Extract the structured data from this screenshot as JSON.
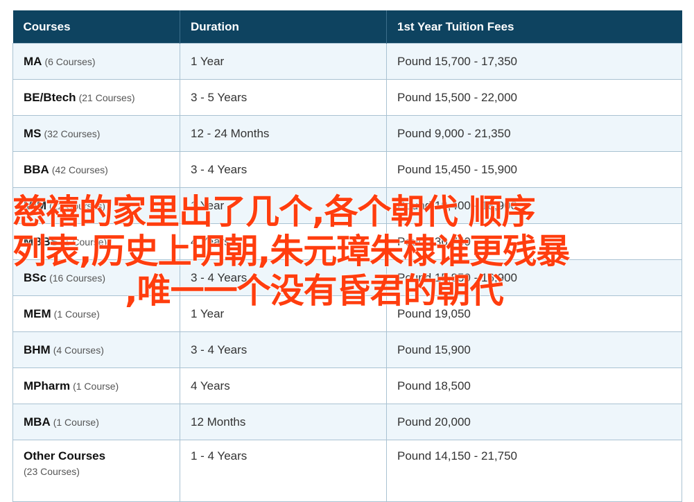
{
  "table": {
    "headers": [
      "Courses",
      "Duration",
      "1st Year Tuition Fees"
    ],
    "rows": [
      {
        "name": "MA",
        "count": "(6 Courses)",
        "duration": "1 Year",
        "fee": "Pound 15,700 - 17,350"
      },
      {
        "name": "BE/Btech",
        "count": "(21 Courses)",
        "duration": "3 - 5 Years",
        "fee": "Pound 15,500 - 22,000"
      },
      {
        "name": "MS",
        "count": "(32 Courses)",
        "duration": "12 - 24 Months",
        "fee": "Pound 9,000 - 21,350"
      },
      {
        "name": "BBA",
        "count": "(42 Courses)",
        "duration": "3 - 4 Years",
        "fee": "Pound 15,450 - 15,900"
      },
      {
        "name": "MIM",
        "count": "(22 Courses)",
        "duration": "1 Year",
        "fee": "Pound 19,400 - 18,900"
      },
      {
        "name": "MBBS",
        "count": "(1 Course)",
        "duration": "4 Years",
        "fee": "Pound 36,750"
      },
      {
        "name": "BSc",
        "count": "(16 Courses)",
        "duration": "3 - 4 Years",
        "fee": "Pound 15,850 - 16,900"
      },
      {
        "name": "MEM",
        "count": "(1 Course)",
        "duration": "1 Year",
        "fee": "Pound 19,050"
      },
      {
        "name": "BHM",
        "count": "(4 Courses)",
        "duration": "3 - 4 Years",
        "fee": "Pound 15,900"
      },
      {
        "name": "MPharm",
        "count": "(1 Course)",
        "duration": "4 Years",
        "fee": "Pound 18,500"
      },
      {
        "name": "MBA",
        "count": "(1 Course)",
        "duration": "12 Months",
        "fee": "Pound 20,000"
      },
      {
        "name": "Other Courses",
        "count": "(23 Courses)",
        "duration": "1 - 4 Years",
        "fee": "Pound 14,150 - 21,750"
      }
    ]
  },
  "overlay": {
    "lines": [
      "慈禧的家里出了几个,各个朝代 顺序",
      "列表,历史上明朝,朱元璋朱棣谁更残暴",
      ",唯一一个没有昏君的朝代"
    ]
  },
  "colors": {
    "header_bg": "#0e4360",
    "row_alt_bg": "#eef6fb",
    "border": "#a9c2d2",
    "overlay_text": "#ff3d0e"
  }
}
